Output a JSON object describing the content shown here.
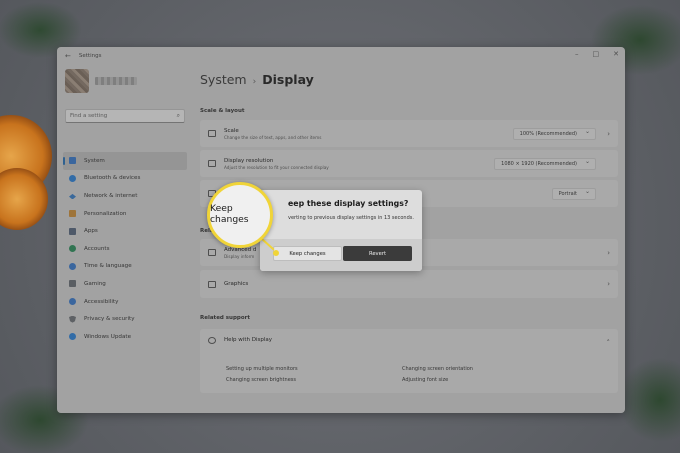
{
  "window": {
    "app_title": "Settings",
    "controls": [
      "–",
      "□",
      "✕"
    ]
  },
  "sidebar": {
    "search_placeholder": "Find a setting",
    "items": [
      {
        "label": "System",
        "icon": "system-icon",
        "color": "#3a76c4",
        "active": true
      },
      {
        "label": "Bluetooth & devices",
        "icon": "bluetooth-icon",
        "color": "#2f7fd0"
      },
      {
        "label": "Network & internet",
        "icon": "network-icon",
        "color": "#3a7bc0"
      },
      {
        "label": "Personalization",
        "icon": "personalization-icon",
        "color": "#c48a3a"
      },
      {
        "label": "Apps",
        "icon": "apps-icon",
        "color": "#55657a"
      },
      {
        "label": "Accounts",
        "icon": "accounts-icon",
        "color": "#2d8a5a"
      },
      {
        "label": "Time & language",
        "icon": "time-language-icon",
        "color": "#3a76c4"
      },
      {
        "label": "Gaming",
        "icon": "gaming-icon",
        "color": "#666b72"
      },
      {
        "label": "Accessibility",
        "icon": "accessibility-icon",
        "color": "#3a76c4"
      },
      {
        "label": "Privacy & security",
        "icon": "privacy-shield-icon",
        "color": "#6b6f75"
      },
      {
        "label": "Windows Update",
        "icon": "windows-update-icon",
        "color": "#2f7fd0"
      }
    ]
  },
  "main": {
    "breadcrumb_parent": "System",
    "breadcrumb_separator": "›",
    "breadcrumb_current": "Display",
    "scale_layout_header": "Scale & layout",
    "scale": {
      "title": "Scale",
      "subtitle": "Change the size of text, apps, and other items",
      "value": "100% (Recommended)"
    },
    "resolution": {
      "title": "Display resolution",
      "subtitle": "Adjust the resolution to fit your connected display",
      "value": "1080 × 1920 (Recommended)"
    },
    "orientation": {
      "value": "Portrait"
    },
    "related_partial": "Relat",
    "advanced": {
      "title": "Advanced d",
      "subtitle": "Display inform"
    },
    "graphics": {
      "title": "Graphics"
    },
    "related_support_header": "Related support",
    "help": {
      "title": "Help with Display"
    },
    "help_links": [
      "Setting up multiple monitors",
      "Changing screen orientation",
      "Changing screen brightness",
      "Adjusting font size"
    ]
  },
  "dialog": {
    "title": "eep these display settings?",
    "message": "verting to previous display settings in 13 seconds.",
    "keep_label": "Keep changes",
    "revert_label": "Revert"
  },
  "callout": {
    "text": "Keep changes",
    "color": "#f0d438"
  }
}
